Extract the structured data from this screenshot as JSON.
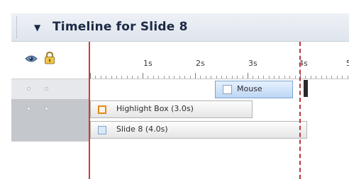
{
  "panel": {
    "collapse_glyph": "▼",
    "title": "Timeline for Slide 8"
  },
  "left_column": {
    "eye_icon": "eye-icon",
    "lock_icon": "lock-icon"
  },
  "ruler": {
    "ticks": [
      "1s",
      "2s",
      "3s",
      "4s",
      "5"
    ]
  },
  "tracks": [
    {
      "label": "Mouse",
      "icon": "mouse-icon"
    },
    {
      "label": "Highlight Box (3.0s)",
      "icon": "highlight-box-icon"
    },
    {
      "label": "Slide 8 (4.0s)",
      "icon": "slide-icon"
    }
  ],
  "colors": {
    "playhead": "#b83a3a",
    "start_line": "#d03a3a",
    "highlight_accent": "#e48a16",
    "mouse_bar": "#bcd6f4"
  }
}
